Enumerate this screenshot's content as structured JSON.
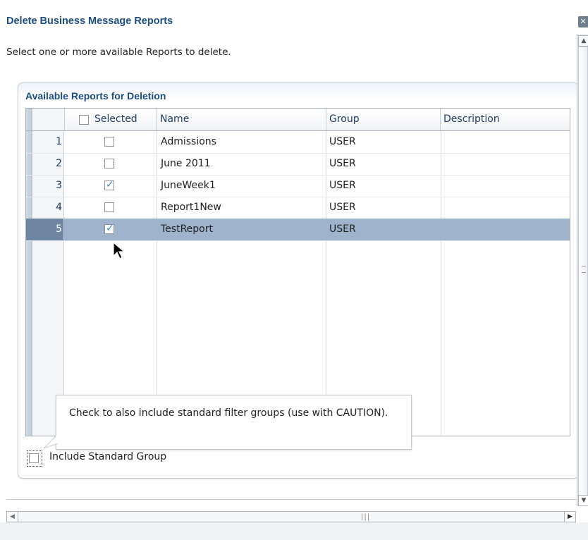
{
  "dialog": {
    "title": "Delete Business Message Reports",
    "close_icon": "close-icon",
    "instruction": "Select one or more available Reports to delete."
  },
  "panel": {
    "title": "Available Reports for Deletion"
  },
  "table": {
    "columns": {
      "selected": "Selected",
      "name": "Name",
      "group": "Group",
      "description": "Description"
    },
    "header_checkbox_checked": false,
    "rows": [
      {
        "num": "1",
        "checked": false,
        "name": "Admissions",
        "group": "USER",
        "description": "",
        "selected": false
      },
      {
        "num": "2",
        "checked": false,
        "name": "June 2011",
        "group": "USER",
        "description": "",
        "selected": false
      },
      {
        "num": "3",
        "checked": true,
        "name": "JuneWeek1",
        "group": "USER",
        "description": "",
        "selected": false
      },
      {
        "num": "4",
        "checked": false,
        "name": "Report1New",
        "group": "USER",
        "description": "",
        "selected": false
      },
      {
        "num": "5",
        "checked": true,
        "name": "TestReport",
        "group": "USER",
        "description": "",
        "selected": true
      }
    ]
  },
  "tooltip": {
    "text": "Check to also include standard filter groups (use with CAUTION)."
  },
  "include_standard_group": {
    "label": "Include Standard Group",
    "checked": false
  },
  "colors": {
    "title": "#1d4d82",
    "selected_row": "#9fb4cc",
    "selected_row_num": "#6f86a2",
    "check_mark": "#3a82c8"
  },
  "icons": {
    "close": "close-icon",
    "scroll_up": "arrow-up-icon",
    "scroll_down": "arrow-down-icon",
    "scroll_left": "arrow-left-icon",
    "scroll_right": "arrow-right-icon",
    "cursor": "mouse-pointer-icon"
  }
}
